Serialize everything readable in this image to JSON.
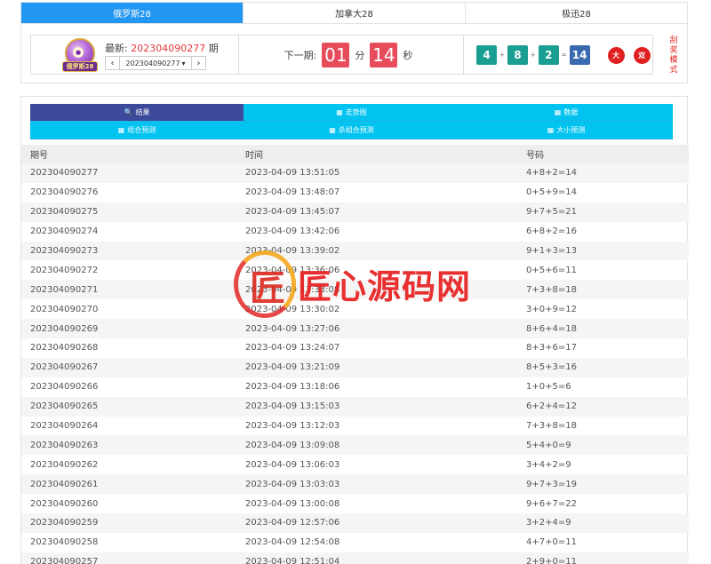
{
  "top_tabs": [
    {
      "label": "俄罗斯28",
      "active": true
    },
    {
      "label": "加拿大28",
      "active": false
    },
    {
      "label": "极迅28",
      "active": false
    }
  ],
  "header": {
    "logo_text": "俄罗斯28",
    "latest_label": "最新:",
    "latest_issue": "202304090277",
    "issue_suffix": "期",
    "prev_glyph": "‹",
    "next_glyph": "›",
    "selected_issue": "202304090277",
    "select_caret": "▾",
    "next_draw_label": "下一期:",
    "countdown_min": "01",
    "min_unit": "分",
    "countdown_sec": "14",
    "sec_unit": "秒",
    "result": {
      "n1": "4",
      "n2": "8",
      "n3": "2",
      "sum": "14",
      "plus": "+",
      "equals": "=",
      "size_badge": "大",
      "parity_badge": "双"
    },
    "scratch_mode": "刮奖模式"
  },
  "nav": [
    {
      "label": "结果",
      "icon": "🔍",
      "active": true
    },
    {
      "label": "走势图",
      "icon": "▦",
      "active": false
    },
    {
      "label": "数据",
      "icon": "▦",
      "active": false
    },
    {
      "label": "组合预测",
      "icon": "▦",
      "active": false
    },
    {
      "label": "杀组合预测",
      "icon": "▦",
      "active": false
    },
    {
      "label": "大小预测",
      "icon": "▦",
      "active": false
    }
  ],
  "table": {
    "headers": [
      "期号",
      "时间",
      "号码"
    ],
    "rows": [
      [
        "202304090277",
        "2023-04-09 13:51:05",
        "4+8+2=14"
      ],
      [
        "202304090276",
        "2023-04-09 13:48:07",
        "0+5+9=14"
      ],
      [
        "202304090275",
        "2023-04-09 13:45:07",
        "9+7+5=21"
      ],
      [
        "202304090274",
        "2023-04-09 13:42:06",
        "6+8+2=16"
      ],
      [
        "202304090273",
        "2023-04-09 13:39:02",
        "9+1+3=13"
      ],
      [
        "202304090272",
        "2023-04-09 13:36:06",
        "0+5+6=11"
      ],
      [
        "202304090271",
        "2023-04-09 13:33:08",
        "7+3+8=18"
      ],
      [
        "202304090270",
        "2023-04-09 13:30:02",
        "3+0+9=12"
      ],
      [
        "202304090269",
        "2023-04-09 13:27:06",
        "8+6+4=18"
      ],
      [
        "202304090268",
        "2023-04-09 13:24:07",
        "8+3+6=17"
      ],
      [
        "202304090267",
        "2023-04-09 13:21:09",
        "8+5+3=16"
      ],
      [
        "202304090266",
        "2023-04-09 13:18:06",
        "1+0+5=6"
      ],
      [
        "202304090265",
        "2023-04-09 13:15:03",
        "6+2+4=12"
      ],
      [
        "202304090264",
        "2023-04-09 13:12:03",
        "7+3+8=18"
      ],
      [
        "202304090263",
        "2023-04-09 13:09:08",
        "5+4+0=9"
      ],
      [
        "202304090262",
        "2023-04-09 13:06:03",
        "3+4+2=9"
      ],
      [
        "202304090261",
        "2023-04-09 13:03:03",
        "9+7+3=19"
      ],
      [
        "202304090260",
        "2023-04-09 13:00:08",
        "9+6+7=22"
      ],
      [
        "202304090259",
        "2023-04-09 12:57:06",
        "3+2+4=9"
      ],
      [
        "202304090258",
        "2023-04-09 12:54:08",
        "4+7+0=11"
      ],
      [
        "202304090257",
        "2023-04-09 12:51:04",
        "2+9+0=11"
      ]
    ]
  },
  "watermark": {
    "glyph": "匠",
    "text": "匠心源码网"
  },
  "colors": {
    "tab_active": "#2196f3",
    "nav_active": "#3b4a9a",
    "nav_bg": "#00c3f0",
    "countdown": "#e74c5b",
    "ball": "#1a9e91",
    "sum_ball": "#3a6aae",
    "badge": "#e02020",
    "issue_red": "#e4393c"
  }
}
